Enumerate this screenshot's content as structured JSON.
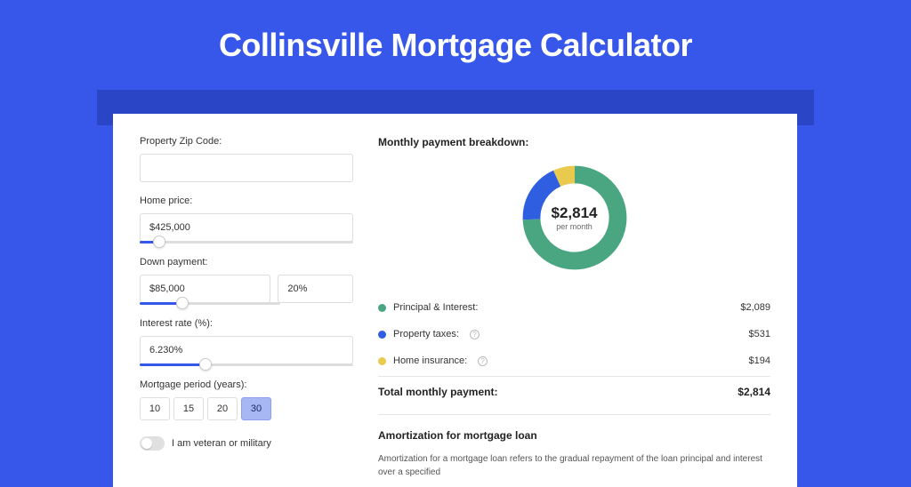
{
  "page": {
    "title": "Collinsville Mortgage Calculator"
  },
  "form": {
    "zip": {
      "label": "Property Zip Code:",
      "value": ""
    },
    "home_price": {
      "label": "Home price:",
      "value": "$425,000",
      "slider_pct": 9
    },
    "down_payment": {
      "label": "Down payment:",
      "amount": "$85,000",
      "percent": "20%",
      "slider_pct": 20
    },
    "interest": {
      "label": "Interest rate (%):",
      "value": "6.230%",
      "slider_pct": 31
    },
    "period": {
      "label": "Mortgage period (years):",
      "options": [
        "10",
        "15",
        "20",
        "30"
      ],
      "selected": "30"
    },
    "veteran": {
      "label": "I am veteran or military",
      "checked": false
    }
  },
  "breakdown": {
    "title": "Monthly payment breakdown:",
    "donut": {
      "amount": "$2,814",
      "sub": "per month"
    },
    "items": [
      {
        "label": "Principal & Interest:",
        "value": "$2,089",
        "color": "#4aa581",
        "info": false,
        "num": 2089
      },
      {
        "label": "Property taxes:",
        "value": "$531",
        "color": "#2f5fe0",
        "info": true,
        "num": 531
      },
      {
        "label": "Home insurance:",
        "value": "$194",
        "color": "#eac94f",
        "info": true,
        "num": 194
      }
    ],
    "total": {
      "label": "Total monthly payment:",
      "value": "$2,814",
      "num": 2814
    }
  },
  "amort": {
    "title": "Amortization for mortgage loan",
    "text": "Amortization for a mortgage loan refers to the gradual repayment of the loan principal and interest over a specified"
  },
  "chart_data": {
    "type": "pie",
    "title": "Monthly payment breakdown",
    "categories": [
      "Principal & Interest",
      "Property taxes",
      "Home insurance"
    ],
    "values": [
      2089,
      531,
      194
    ],
    "colors": [
      "#4aa581",
      "#2f5fe0",
      "#eac94f"
    ],
    "total": 2814,
    "center_label": "$2,814 per month"
  }
}
